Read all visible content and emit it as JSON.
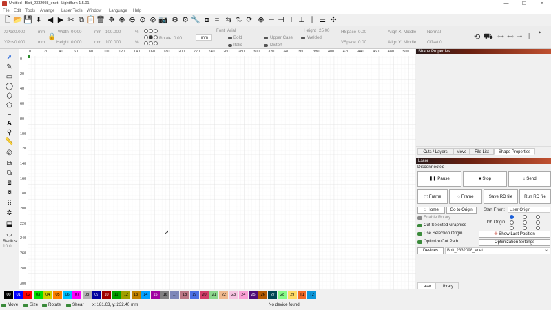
{
  "window": {
    "title": "Untitled - Bolt_2332098_enet - LightBurn 1.5.01",
    "min": "—",
    "max": "☐",
    "close": "✕"
  },
  "menu": [
    "File",
    "Edit",
    "Tools",
    "Arrange",
    "Laser Tools",
    "Window",
    "Language",
    "Help"
  ],
  "props": {
    "xpos_label": "XPos",
    "xpos_value": "0.000",
    "xpos_unit": "mm",
    "ypos_label": "YPos",
    "ypos_value": "0.000",
    "ypos_unit": "mm",
    "width_label": "Width",
    "width_value": "0.000",
    "width_unit": "mm",
    "width_pct": "100.000",
    "width_pct_unit": "%",
    "height_label": "Height",
    "height_value": "0.000",
    "height_unit": "mm",
    "height_pct": "100.000",
    "height_pct_unit": "%",
    "rotate_label": "Rotate",
    "rotate_value": "0.00",
    "units_value": "mm",
    "font_label": "Font",
    "font_value": "Arial",
    "bold": "Bold",
    "italic": "Italic",
    "upper_case": "Upper Case",
    "distort": "Distort",
    "welded": "Welded",
    "fontheight_label": "Height",
    "fontheight_value": "25.00",
    "hspace_label": "HSpace",
    "hspace_value": "0.00",
    "vspace_label": "VSpace",
    "vspace_value": "0.00",
    "alignx_label": "Align X",
    "alignx_value": "Middle",
    "aligny_label": "Align Y",
    "aligny_value": "Middle",
    "mode_value": "Normal",
    "offset_value": "Offset 0"
  },
  "ruler": {
    "x": [
      "0",
      "20",
      "40",
      "60",
      "80",
      "100",
      "120",
      "140",
      "160",
      "180",
      "200",
      "220",
      "240",
      "260",
      "280",
      "300",
      "320",
      "340",
      "360",
      "380",
      "400",
      "420",
      "440",
      "460",
      "480",
      "500"
    ],
    "y": [
      "0",
      "20",
      "40",
      "60",
      "80",
      "100",
      "120",
      "140",
      "160",
      "180",
      "200",
      "220",
      "240",
      "260",
      "280",
      "300"
    ]
  },
  "left_tools": {
    "radius_label": "Radius:",
    "radius_value": "10.0"
  },
  "shape_panel": {
    "title": "Shape Properties"
  },
  "right_tabs": [
    "Cuts / Layers",
    "Move",
    "File List",
    "Shape Properties"
  ],
  "laser": {
    "title": "Laser",
    "status": "Disconnected",
    "pause": "Pause",
    "stop": "Stop",
    "send": "Send",
    "frame1": "Frame",
    "frame2": "Frame",
    "save_rd": "Save RD file",
    "run_rd": "Run RD file",
    "home": "Home",
    "go_origin": "Go to Origin",
    "start_from_label": "Start From:",
    "start_from_value": "User Origin",
    "enable_rotary": "Enable Rotary",
    "cut_selected": "Cut Selected Graphics",
    "use_selection_origin": "Use Selection Origin",
    "optimize_cut": "Optimize Cut Path",
    "job_origin_label": "Job Origin",
    "show_last": "Show Last Position",
    "opt_settings": "Optimization Settings",
    "devices_label": "Devices",
    "device_value": "Bolt_2332098_enet"
  },
  "bottom_tabs": [
    "Laser",
    "Library"
  ],
  "palette": [
    {
      "label": "00",
      "color": "#000000",
      "text": "#ffffff"
    },
    {
      "label": "01",
      "color": "#0000ff",
      "text": "#ffffff"
    },
    {
      "label": "02",
      "color": "#ff0000",
      "text": "#000000"
    },
    {
      "label": "03",
      "color": "#00e000",
      "text": "#000000"
    },
    {
      "label": "04",
      "color": "#d0d000",
      "text": "#000000"
    },
    {
      "label": "05",
      "color": "#ff8000",
      "text": "#000000"
    },
    {
      "label": "06",
      "color": "#00c0ff",
      "text": "#000000"
    },
    {
      "label": "07",
      "color": "#ff00ff",
      "text": "#000000"
    },
    {
      "label": "08",
      "color": "#b4b4b4",
      "text": "#000000"
    },
    {
      "label": "09",
      "color": "#0000a0",
      "text": "#ffffff"
    },
    {
      "label": "10",
      "color": "#a00000",
      "text": "#ffffff"
    },
    {
      "label": "11",
      "color": "#00a000",
      "text": "#000000"
    },
    {
      "label": "12",
      "color": "#a0a000",
      "text": "#000000"
    },
    {
      "label": "13",
      "color": "#c08000",
      "text": "#000000"
    },
    {
      "label": "14",
      "color": "#00a0ff",
      "text": "#000000"
    },
    {
      "label": "15",
      "color": "#a000a0",
      "text": "#ffffff"
    },
    {
      "label": "16",
      "color": "#808080",
      "text": "#000000"
    },
    {
      "label": "17",
      "color": "#7d87b9",
      "text": "#000000"
    },
    {
      "label": "18",
      "color": "#bb7784",
      "text": "#000000"
    },
    {
      "label": "19",
      "color": "#4a6fe3",
      "text": "#000000"
    },
    {
      "label": "20",
      "color": "#d33f6a",
      "text": "#000000"
    },
    {
      "label": "21",
      "color": "#8cd78c",
      "text": "#000000"
    },
    {
      "label": "22",
      "color": "#f0b98d",
      "text": "#000000"
    },
    {
      "label": "23",
      "color": "#f6c4e1",
      "text": "#000000"
    },
    {
      "label": "24",
      "color": "#fa9ed4",
      "text": "#000000"
    },
    {
      "label": "25",
      "color": "#500a78",
      "text": "#ffffff"
    },
    {
      "label": "26",
      "color": "#b45a00",
      "text": "#000000"
    },
    {
      "label": "27",
      "color": "#004754",
      "text": "#ffffff"
    },
    {
      "label": "28",
      "color": "#86fa88",
      "text": "#000000"
    },
    {
      "label": "29",
      "color": "#ffdb66",
      "text": "#000000"
    },
    {
      "label": "T1",
      "color": "#f36926",
      "text": "#000000"
    },
    {
      "label": "T2",
      "color": "#0c96d9",
      "text": "#000000"
    }
  ],
  "status": {
    "move": "Move",
    "size": "Size",
    "rotate": "Rotate",
    "shear": "Shear",
    "coords": "x: 181.63, y: 232.40 mm",
    "device": "No device found"
  }
}
